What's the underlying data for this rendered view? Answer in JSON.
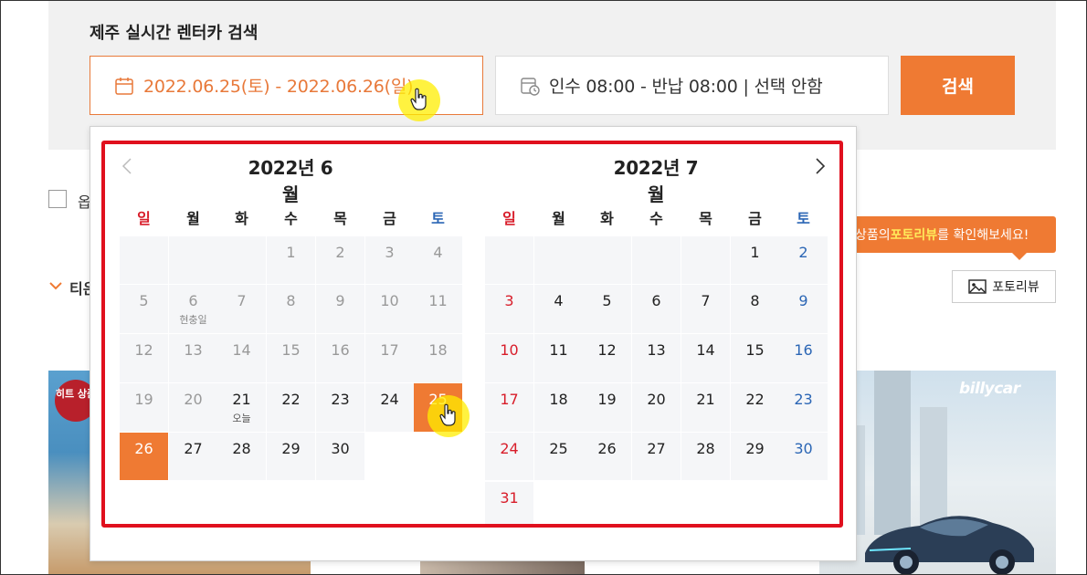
{
  "search": {
    "title": "제주 실시간 렌터카 검색",
    "date_range": "2022.06.25(토) - 2022.06.26(일)",
    "time_summary": "인수 08:00 - 반납 08:00 | 선택 안함",
    "search_button": "검색",
    "accent_color": "#ef7a33"
  },
  "background": {
    "checkbox_label": "옵",
    "sort_label": "티은",
    "tooltip_prefix": "상품의 ",
    "tooltip_highlight": "포토리뷰",
    "tooltip_suffix": "를 확인해보세요!",
    "photo_review_button": "포토리뷰",
    "hit_badge": "히트 상품",
    "brand_logo": "billycar"
  },
  "calendar": {
    "weekdays": [
      "일",
      "월",
      "화",
      "수",
      "목",
      "금",
      "토"
    ],
    "months": [
      {
        "title": "2022년 6월",
        "weeks": [
          [
            null,
            null,
            null,
            {
              "d": "1",
              "past": true
            },
            {
              "d": "2",
              "past": true
            },
            {
              "d": "3",
              "past": true
            },
            {
              "d": "4",
              "past": true
            }
          ],
          [
            {
              "d": "5",
              "past": true
            },
            {
              "d": "6",
              "past": true,
              "sub": "현충일"
            },
            {
              "d": "7",
              "past": true
            },
            {
              "d": "8",
              "past": true
            },
            {
              "d": "9",
              "past": true
            },
            {
              "d": "10",
              "past": true
            },
            {
              "d": "11",
              "past": true
            }
          ],
          [
            {
              "d": "12",
              "past": true
            },
            {
              "d": "13",
              "past": true
            },
            {
              "d": "14",
              "past": true
            },
            {
              "d": "15",
              "past": true
            },
            {
              "d": "16",
              "past": true
            },
            {
              "d": "17",
              "past": true
            },
            {
              "d": "18",
              "past": true
            }
          ],
          [
            {
              "d": "19",
              "past": true
            },
            {
              "d": "20",
              "past": true
            },
            {
              "d": "21",
              "sub": "오늘"
            },
            {
              "d": "22"
            },
            {
              "d": "23"
            },
            {
              "d": "24"
            },
            {
              "d": "25",
              "sel": true
            }
          ],
          [
            {
              "d": "26",
              "sel": true
            },
            {
              "d": "27"
            },
            {
              "d": "28"
            },
            {
              "d": "29"
            },
            {
              "d": "30"
            }
          ]
        ]
      },
      {
        "title": "2022년 7월",
        "weeks": [
          [
            null,
            null,
            null,
            null,
            null,
            {
              "d": "1"
            },
            {
              "d": "2"
            }
          ],
          [
            {
              "d": "3"
            },
            {
              "d": "4"
            },
            {
              "d": "5"
            },
            {
              "d": "6"
            },
            {
              "d": "7"
            },
            {
              "d": "8"
            },
            {
              "d": "9"
            }
          ],
          [
            {
              "d": "10"
            },
            {
              "d": "11"
            },
            {
              "d": "12"
            },
            {
              "d": "13"
            },
            {
              "d": "14"
            },
            {
              "d": "15"
            },
            {
              "d": "16"
            }
          ],
          [
            {
              "d": "17"
            },
            {
              "d": "18"
            },
            {
              "d": "19"
            },
            {
              "d": "20"
            },
            {
              "d": "21"
            },
            {
              "d": "22"
            },
            {
              "d": "23"
            }
          ],
          [
            {
              "d": "24"
            },
            {
              "d": "25"
            },
            {
              "d": "26"
            },
            {
              "d": "27"
            },
            {
              "d": "28"
            },
            {
              "d": "29"
            },
            {
              "d": "30"
            }
          ],
          [
            {
              "d": "31"
            }
          ]
        ]
      }
    ]
  }
}
